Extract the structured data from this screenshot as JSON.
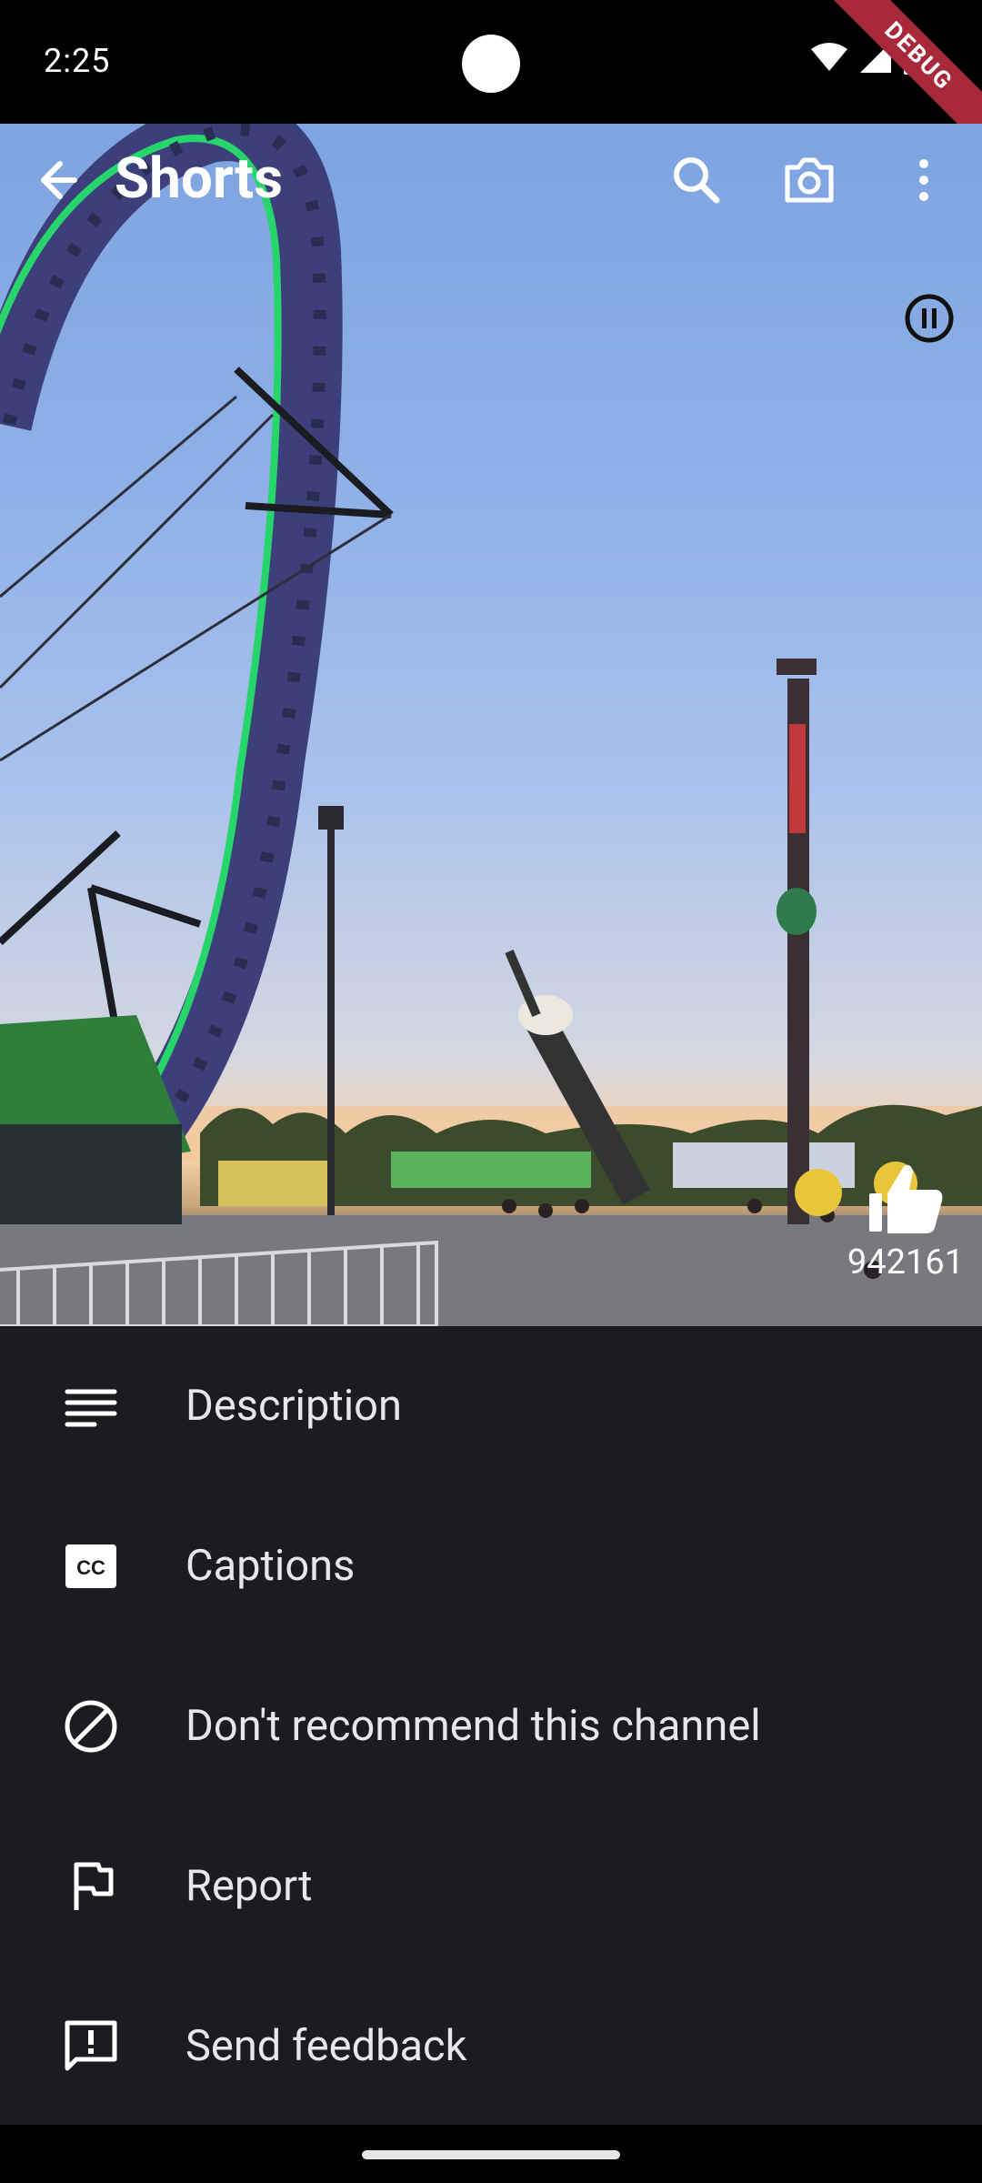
{
  "status": {
    "time": "2:25",
    "debug": "DEBUG"
  },
  "header": {
    "title": "Shorts"
  },
  "short": {
    "like_count": "942161"
  },
  "menu": [
    {
      "label": "Description",
      "icon": "description-icon"
    },
    {
      "label": "Captions",
      "icon": "captions-icon"
    },
    {
      "label": "Don't recommend this channel",
      "icon": "block-icon"
    },
    {
      "label": "Report",
      "icon": "flag-icon"
    },
    {
      "label": "Send feedback",
      "icon": "feedback-icon"
    }
  ],
  "colors": {
    "sheet_bg": "#1c1b1f",
    "text": "#e8e6ea",
    "debug": "#a8293a"
  }
}
